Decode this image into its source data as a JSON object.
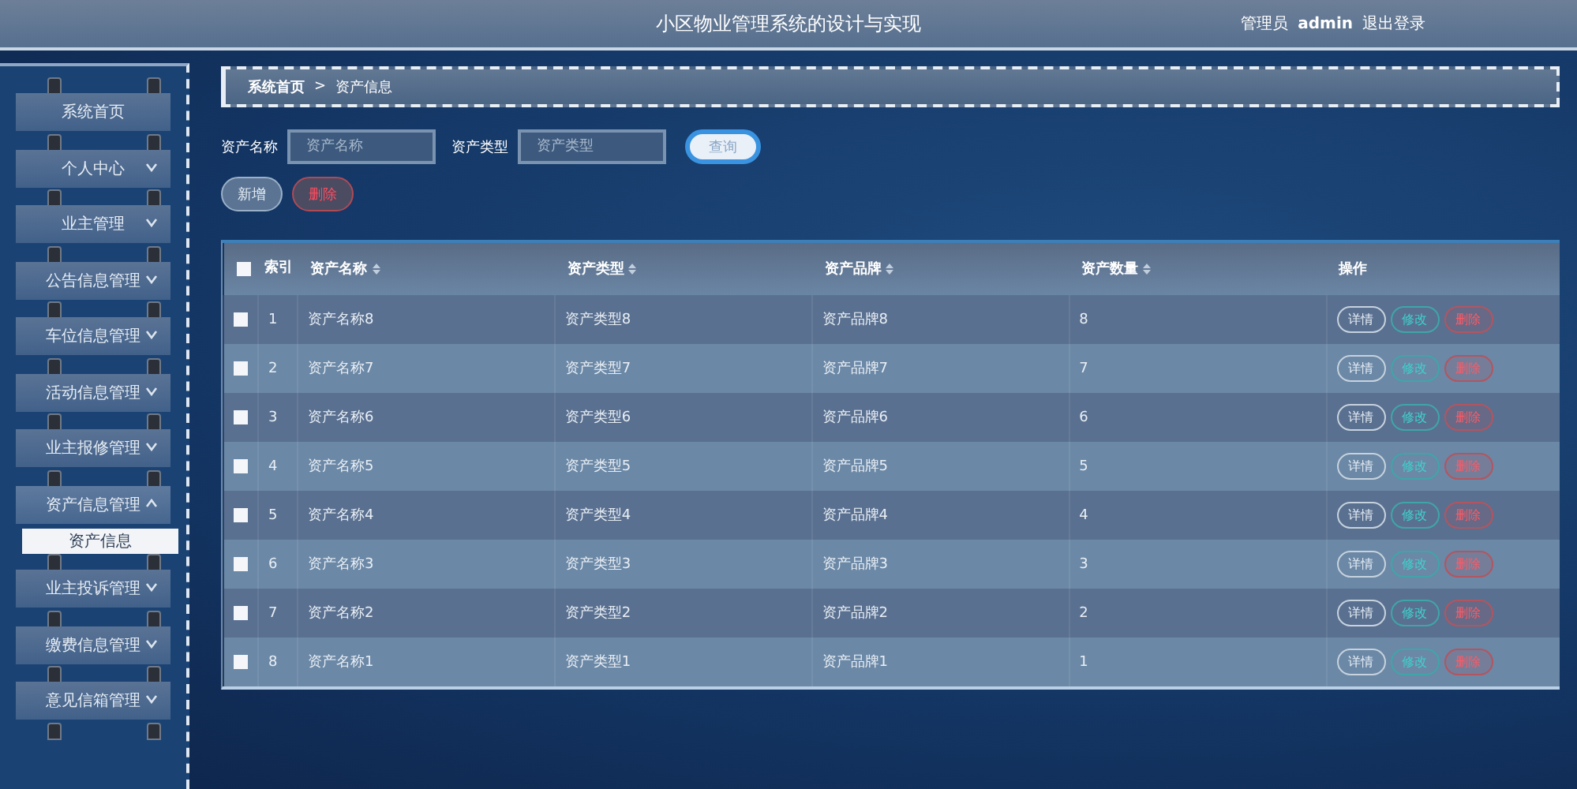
{
  "header": {
    "title": "小区物业管理系统的设计与实现",
    "user_role": "管理员",
    "user_name": "admin",
    "logout": "退出登录"
  },
  "sidebar": {
    "items": [
      {
        "label": "系统首页",
        "kind": "link"
      },
      {
        "label": "个人中心",
        "kind": "group",
        "expanded": false
      },
      {
        "label": "业主管理",
        "kind": "group",
        "expanded": false
      },
      {
        "label": "公告信息管理",
        "kind": "group",
        "expanded": false
      },
      {
        "label": "车位信息管理",
        "kind": "group",
        "expanded": false
      },
      {
        "label": "活动信息管理",
        "kind": "group",
        "expanded": false
      },
      {
        "label": "业主报修管理",
        "kind": "group",
        "expanded": false
      },
      {
        "label": "资产信息管理",
        "kind": "group",
        "expanded": true,
        "children": [
          {
            "label": "资产信息",
            "selected": true
          }
        ]
      },
      {
        "label": "业主投诉管理",
        "kind": "group",
        "expanded": false
      },
      {
        "label": "缴费信息管理",
        "kind": "group",
        "expanded": false
      },
      {
        "label": "意见信箱管理",
        "kind": "group",
        "expanded": false
      }
    ]
  },
  "breadcrumb": {
    "home": "系统首页",
    "separator": ">",
    "current": "资产信息"
  },
  "search": {
    "fields": [
      {
        "label": "资产名称",
        "placeholder": "资产名称"
      },
      {
        "label": "资产类型",
        "placeholder": "资产类型"
      }
    ],
    "button": "查询"
  },
  "actions": {
    "add": "新增",
    "delete": "删除"
  },
  "table": {
    "select_all": {
      "checked": false
    },
    "columns": [
      {
        "label": "索引",
        "kind": "plain"
      },
      {
        "label": "资产名称",
        "kind": "sortable"
      },
      {
        "label": "资产类型",
        "kind": "sortable"
      },
      {
        "label": "资产品牌",
        "kind": "sortable"
      },
      {
        "label": "资产数量",
        "kind": "sortable"
      },
      {
        "label": "操作",
        "kind": "plain"
      }
    ],
    "rows": [
      {
        "checked": false,
        "cells": [
          "1",
          "资产名称8",
          "资产类型8",
          "资产品牌8",
          "8"
        ],
        "buttons": [
          {
            "kind": "detail",
            "label": "详情"
          },
          {
            "kind": "edit",
            "label": "修改"
          },
          {
            "kind": "delete",
            "label": "删除"
          }
        ]
      },
      {
        "checked": false,
        "cells": [
          "2",
          "资产名称7",
          "资产类型7",
          "资产品牌7",
          "7"
        ],
        "buttons": [
          {
            "kind": "detail",
            "label": "详情"
          },
          {
            "kind": "edit",
            "label": "修改"
          },
          {
            "kind": "delete",
            "label": "删除"
          }
        ]
      },
      {
        "checked": false,
        "cells": [
          "3",
          "资产名称6",
          "资产类型6",
          "资产品牌6",
          "6"
        ],
        "buttons": [
          {
            "kind": "detail",
            "label": "详情"
          },
          {
            "kind": "edit",
            "label": "修改"
          },
          {
            "kind": "delete",
            "label": "删除"
          }
        ]
      },
      {
        "checked": false,
        "cells": [
          "4",
          "资产名称5",
          "资产类型5",
          "资产品牌5",
          "5"
        ],
        "buttons": [
          {
            "kind": "detail",
            "label": "详情"
          },
          {
            "kind": "edit",
            "label": "修改"
          },
          {
            "kind": "delete",
            "label": "删除"
          }
        ]
      },
      {
        "checked": false,
        "cells": [
          "5",
          "资产名称4",
          "资产类型4",
          "资产品牌4",
          "4"
        ],
        "buttons": [
          {
            "kind": "detail",
            "label": "详情"
          },
          {
            "kind": "edit",
            "label": "修改"
          },
          {
            "kind": "delete",
            "label": "删除"
          }
        ]
      },
      {
        "checked": false,
        "cells": [
          "6",
          "资产名称3",
          "资产类型3",
          "资产品牌3",
          "3"
        ],
        "buttons": [
          {
            "kind": "detail",
            "label": "详情"
          },
          {
            "kind": "edit",
            "label": "修改"
          },
          {
            "kind": "delete",
            "label": "删除"
          }
        ]
      },
      {
        "checked": false,
        "cells": [
          "7",
          "资产名称2",
          "资产类型2",
          "资产品牌2",
          "2"
        ],
        "buttons": [
          {
            "kind": "detail",
            "label": "详情"
          },
          {
            "kind": "edit",
            "label": "修改"
          },
          {
            "kind": "delete",
            "label": "删除"
          }
        ]
      },
      {
        "checked": false,
        "cells": [
          "8",
          "资产名称1",
          "资产类型1",
          "资产品牌1",
          "1"
        ],
        "buttons": [
          {
            "kind": "detail",
            "label": "详情"
          },
          {
            "kind": "edit",
            "label": "修改"
          },
          {
            "kind": "delete",
            "label": "删除"
          }
        ]
      }
    ]
  }
}
